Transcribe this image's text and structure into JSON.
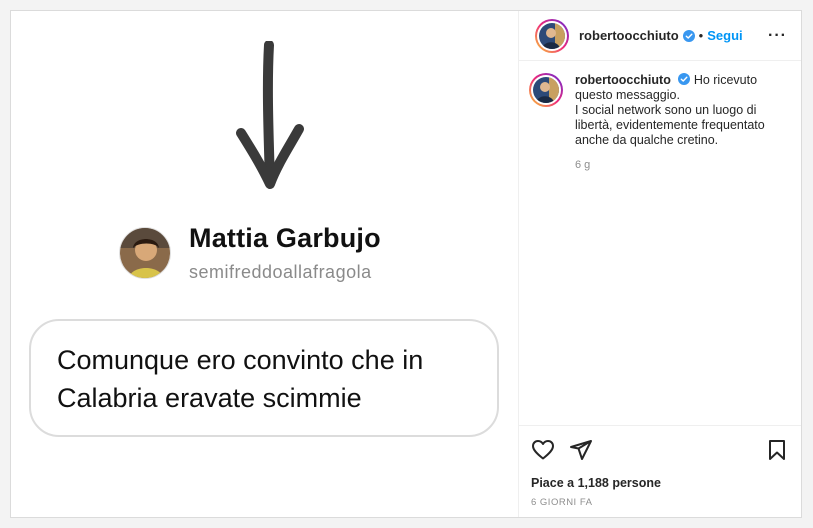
{
  "media": {
    "sender_name": "Mattia Garbujo",
    "sender_handle": "semifreddoallafragola",
    "message_text": "Comunque ero convinto che in Calabria eravate scimmie",
    "arrow_icon": "hand-drawn-down-arrow-icon"
  },
  "header": {
    "username": "robertoocchiuto",
    "separator": "•",
    "follow_label": "Segui",
    "more_label": "···"
  },
  "caption": {
    "username": "robertoocchiuto",
    "text_line1": "Ho ricevuto questo messaggio.",
    "text_line2": "I social network sono un luogo di libertà, evidentemente frequentato anche da qualche cretino.",
    "time": "6 g"
  },
  "actions": {
    "likes_text": "Piace a 1,188 persone",
    "posted_ago": "6 GIORNI FA",
    "icons": [
      "heart-icon",
      "share-icon",
      "bookmark-icon"
    ]
  },
  "colors": {
    "accent": "#0095f6",
    "verified": "#3897f0",
    "bubble_border": "#dcdcdc"
  }
}
